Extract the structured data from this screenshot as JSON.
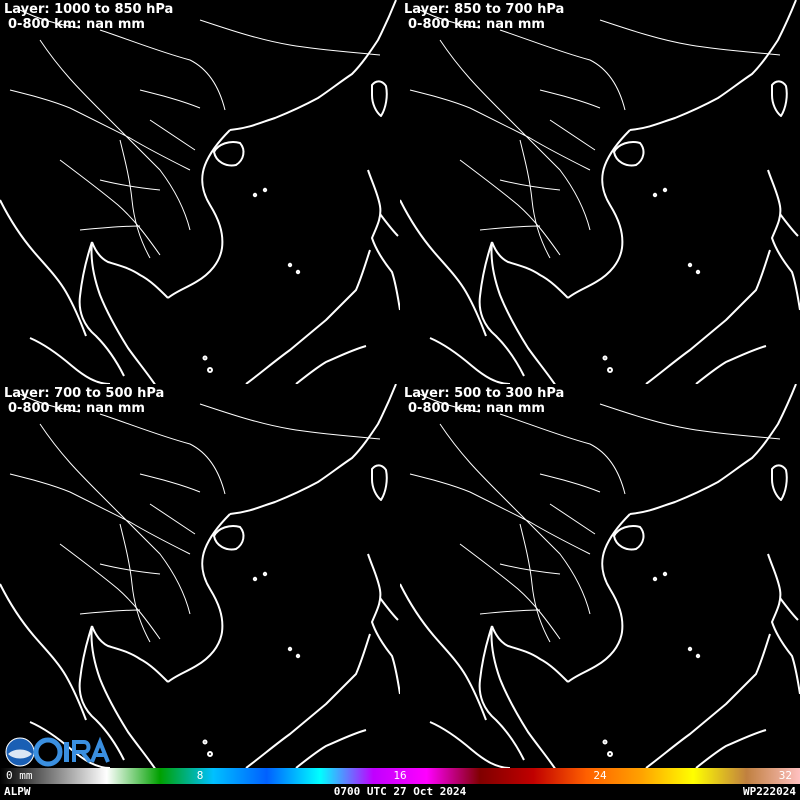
{
  "panels": [
    {
      "title": "Layer: 1000 to 850 hPa",
      "subtitle": "0-800 km: nan mm"
    },
    {
      "title": "Layer: 850 to 700 hPa",
      "subtitle": "0-800 km: nan mm"
    },
    {
      "title": "Layer: 700 to 500 hPa",
      "subtitle": "0-800 km: nan mm"
    },
    {
      "title": "Layer: 500 to 300 hPa",
      "subtitle": "0-800 km: nan mm"
    }
  ],
  "colorbar": {
    "ticks": [
      "0 mm",
      "8",
      "16",
      "24",
      "32"
    ],
    "tick_values": [
      0,
      8,
      16,
      24,
      32
    ],
    "range": [
      0,
      32
    ],
    "colors": [
      "#000000",
      "#808080",
      "#ffffff",
      "#00a000",
      "#00c0ff",
      "#0060ff",
      "#00ffff",
      "#c000ff",
      "#ff00ff",
      "#800000",
      "#c00000",
      "#ff6000",
      "#ffa000",
      "#ffff00",
      "#c08040",
      "#ffc0c0"
    ]
  },
  "footer": {
    "product": "ALPW",
    "timestamp": "0700 UTC 27 Oct 2024",
    "storm_id": "WP222024"
  },
  "logo": {
    "text": "CIRA",
    "icon": "noaa-logo-icon"
  }
}
